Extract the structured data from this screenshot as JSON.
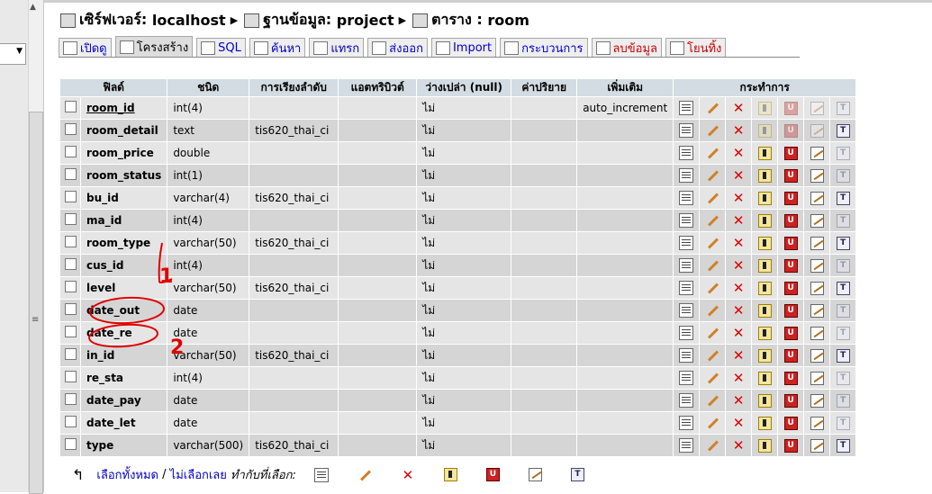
{
  "breadcrumb": {
    "server_label": "เซิร์ฟเวอร์:",
    "server": "localhost",
    "db_label": "ฐานข้อมูล:",
    "database": "project",
    "table_label": "ตาราง :",
    "table": "room"
  },
  "tabs": [
    {
      "label": "เปิดดู",
      "icon": "browse-icon"
    },
    {
      "label": "โครงสร้าง",
      "icon": "structure-icon",
      "active": true
    },
    {
      "label": "SQL",
      "icon": "sql-icon"
    },
    {
      "label": "ค้นหา",
      "icon": "search-icon"
    },
    {
      "label": "แทรก",
      "icon": "insert-icon"
    },
    {
      "label": "ส่งออก",
      "icon": "export-icon"
    },
    {
      "label": "Import",
      "icon": "import-icon"
    },
    {
      "label": "กระบวนการ",
      "icon": "operations-icon"
    },
    {
      "label": "ลบข้อมูล",
      "icon": "empty-icon",
      "danger": true
    },
    {
      "label": "โยนทิ้ง",
      "icon": "drop-icon",
      "danger": true
    }
  ],
  "columns": [
    "ฟิลด์",
    "ชนิด",
    "การเรียงลำดับ",
    "แอตทริบิวต์",
    "ว่างเปล่า (null)",
    "ค่าปริยาย",
    "เพิ่มเติม",
    "กระทำการ"
  ],
  "rows": [
    {
      "field": "room_id",
      "type": "int(4)",
      "collation": "",
      "attributes": "",
      "null": "ไม่",
      "default": "",
      "extra": "auto_increment",
      "pk": true,
      "text_field": false
    },
    {
      "field": "room_detail",
      "type": "text",
      "collation": "tis620_thai_ci",
      "attributes": "",
      "null": "ไม่",
      "default": "",
      "extra": "",
      "pk": false,
      "text_field": true
    },
    {
      "field": "room_price",
      "type": "double",
      "collation": "",
      "attributes": "",
      "null": "ไม่",
      "default": "",
      "extra": "",
      "pk": false,
      "text_field": false
    },
    {
      "field": "room_status",
      "type": "int(1)",
      "collation": "",
      "attributes": "",
      "null": "ไม่",
      "default": "",
      "extra": "",
      "pk": false,
      "text_field": false
    },
    {
      "field": "bu_id",
      "type": "varchar(4)",
      "collation": "tis620_thai_ci",
      "attributes": "",
      "null": "ไม่",
      "default": "",
      "extra": "",
      "pk": false,
      "text_field": true
    },
    {
      "field": "ma_id",
      "type": "int(4)",
      "collation": "",
      "attributes": "",
      "null": "ไม่",
      "default": "",
      "extra": "",
      "pk": false,
      "text_field": false
    },
    {
      "field": "room_type",
      "type": "varchar(50)",
      "collation": "tis620_thai_ci",
      "attributes": "",
      "null": "ไม่",
      "default": "",
      "extra": "",
      "pk": false,
      "text_field": true
    },
    {
      "field": "cus_id",
      "type": "int(4)",
      "collation": "",
      "attributes": "",
      "null": "ไม่",
      "default": "",
      "extra": "",
      "pk": false,
      "text_field": false
    },
    {
      "field": "level",
      "type": "varchar(50)",
      "collation": "tis620_thai_ci",
      "attributes": "",
      "null": "ไม่",
      "default": "",
      "extra": "",
      "pk": false,
      "text_field": true
    },
    {
      "field": "date_out",
      "type": "date",
      "collation": "",
      "attributes": "",
      "null": "ไม่",
      "default": "",
      "extra": "",
      "pk": false,
      "text_field": false
    },
    {
      "field": "date_re",
      "type": "date",
      "collation": "",
      "attributes": "",
      "null": "ไม่",
      "default": "",
      "extra": "",
      "pk": false,
      "text_field": false
    },
    {
      "field": "in_id",
      "type": "varchar(50)",
      "collation": "tis620_thai_ci",
      "attributes": "",
      "null": "ไม่",
      "default": "",
      "extra": "",
      "pk": false,
      "text_field": true
    },
    {
      "field": "re_sta",
      "type": "int(4)",
      "collation": "",
      "attributes": "",
      "null": "ไม่",
      "default": "",
      "extra": "",
      "pk": false,
      "text_field": false
    },
    {
      "field": "date_pay",
      "type": "date",
      "collation": "",
      "attributes": "",
      "null": "ไม่",
      "default": "",
      "extra": "",
      "pk": false,
      "text_field": false
    },
    {
      "field": "date_let",
      "type": "date",
      "collation": "",
      "attributes": "",
      "null": "ไม่",
      "default": "",
      "extra": "",
      "pk": false,
      "text_field": false
    },
    {
      "field": "type",
      "type": "varchar(500)",
      "collation": "tis620_thai_ci",
      "attributes": "",
      "null": "ไม่",
      "default": "",
      "extra": "",
      "pk": false,
      "text_field": true
    }
  ],
  "row_actions": [
    "browse-icon",
    "edit-icon",
    "drop-icon",
    "primary-key-icon",
    "unique-icon",
    "index-icon",
    "fulltext-icon"
  ],
  "footer": {
    "check_all": "เลือกทั้งหมด",
    "separator": "/",
    "uncheck_all": "ไม่เลือกเลย",
    "with_selected": "ทำกับที่เลือก:"
  },
  "annotations": [
    {
      "text": "1",
      "color": "#e00000"
    },
    {
      "text": "2",
      "color": "#e00000"
    }
  ],
  "colors": {
    "header_bg": "#d3dce3",
    "row_even": "#e5e5e5",
    "row_odd": "#d5d5d5",
    "link": "#0000cc",
    "annotation": "#e00000"
  }
}
